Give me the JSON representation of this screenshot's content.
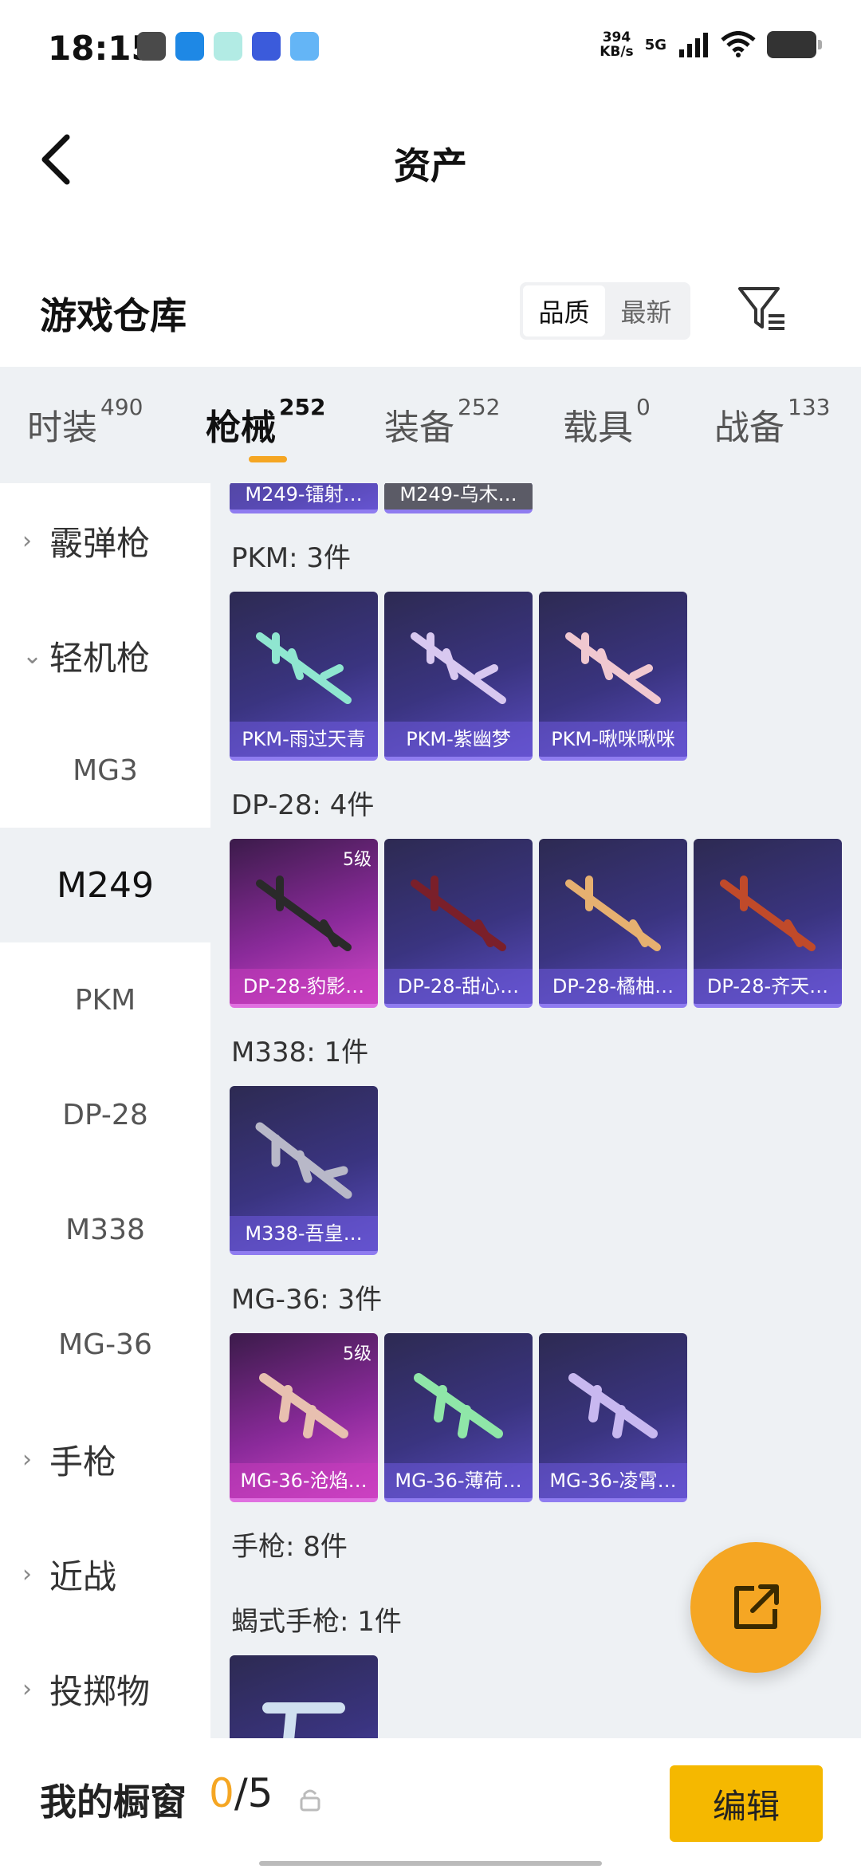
{
  "status": {
    "time": "18:15",
    "net_speed_top": "394",
    "net_speed_bottom": "KB/s",
    "network": "5G"
  },
  "header": {
    "title": "资产"
  },
  "warehouse": {
    "title": "游戏仓库",
    "sort_options": [
      "品质",
      "最新"
    ],
    "sort_active": "品质"
  },
  "tabs": [
    {
      "label": "时装",
      "count": "490"
    },
    {
      "label": "枪械",
      "count": "252"
    },
    {
      "label": "装备",
      "count": "252"
    },
    {
      "label": "载具",
      "count": "0"
    },
    {
      "label": "战备",
      "count": "133"
    }
  ],
  "sidebar": {
    "shotgun": "霰弹枪",
    "lmg": "轻机枪",
    "mg3": "MG3",
    "m249": "M249",
    "pkm": "PKM",
    "dp28": "DP-28",
    "m338": "M338",
    "mg36": "MG-36",
    "pistol": "手枪",
    "melee": "近战",
    "throw": "投掷物"
  },
  "content": {
    "top_partial": [
      "M249-镭射…",
      "M249-乌木…"
    ],
    "pkm_title": "PKM: 3件",
    "pkm_items": [
      "PKM-雨过天青",
      "PKM-紫幽梦",
      "PKM-啾咪啾咪"
    ],
    "dp28_title": "DP-28: 4件",
    "dp28_items": [
      "DP-28-豹影…",
      "DP-28-甜心…",
      "DP-28-橘柚…",
      "DP-28-齐天…"
    ],
    "m338_title": "M338: 1件",
    "m338_items": [
      "M338-吾皇…"
    ],
    "mg36_title": "MG-36: 3件",
    "mg36_items": [
      "MG-36-沧焰…",
      "MG-36-薄荷…",
      "MG-36-凌霄…"
    ],
    "level_badge": "5级",
    "pistol_title": "手枪: 8件",
    "scorpion_title": "蝎式手枪: 1件"
  },
  "bottom": {
    "label": "我的橱窗",
    "current": "0",
    "total": "/5",
    "edit": "编辑"
  },
  "colors": {
    "accent": "#f5a623",
    "edit_button": "#f5b800"
  }
}
